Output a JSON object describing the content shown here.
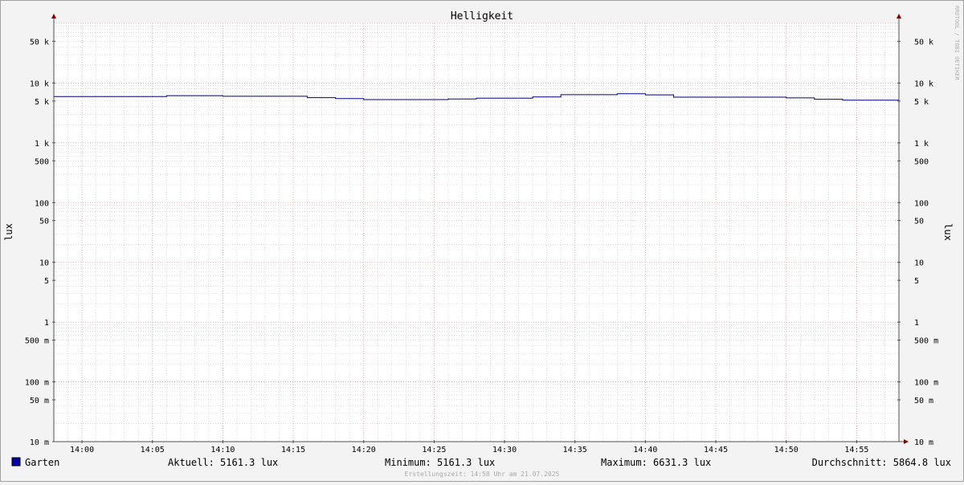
{
  "chart_data": {
    "type": "line",
    "title": "Helligkeit",
    "ylabel": "lux",
    "ylabel_right": "lux",
    "watermark": "RRDTOOL / TOBI OETIKER",
    "scale": "log",
    "ylim": [
      0.01,
      100000
    ],
    "xlim": [
      "13:58",
      "14:58"
    ],
    "grid": true,
    "y_ticks": [
      {
        "value": 50000,
        "label": "50 k"
      },
      {
        "value": 10000,
        "label": "10 k"
      },
      {
        "value": 5000,
        "label": "5 k"
      },
      {
        "value": 1000,
        "label": "1 k"
      },
      {
        "value": 500,
        "label": "500"
      },
      {
        "value": 100,
        "label": "100"
      },
      {
        "value": 50,
        "label": "50"
      },
      {
        "value": 10,
        "label": "10"
      },
      {
        "value": 5,
        "label": "5"
      },
      {
        "value": 1,
        "label": "1"
      },
      {
        "value": 0.5,
        "label": "500 m"
      },
      {
        "value": 0.1,
        "label": "100 m"
      },
      {
        "value": 0.05,
        "label": "50 m"
      },
      {
        "value": 0.01,
        "label": "10 m"
      }
    ],
    "x_ticks": [
      "14:00",
      "14:05",
      "14:10",
      "14:15",
      "14:20",
      "14:25",
      "14:30",
      "14:35",
      "14:40",
      "14:45",
      "14:50",
      "14:55"
    ],
    "series": [
      {
        "name": "Garten",
        "color": "#000080",
        "points": [
          [
            "13:58",
            5950
          ],
          [
            "14:06",
            6150
          ],
          [
            "14:10",
            6000
          ],
          [
            "14:16",
            5700
          ],
          [
            "14:18",
            5500
          ],
          [
            "14:20",
            5300
          ],
          [
            "14:26",
            5400
          ],
          [
            "14:28",
            5600
          ],
          [
            "14:32",
            5850
          ],
          [
            "14:34",
            6400
          ],
          [
            "14:38",
            6631.3
          ],
          [
            "14:40",
            6350
          ],
          [
            "14:42",
            5800
          ],
          [
            "14:50",
            5650
          ],
          [
            "14:52",
            5350
          ],
          [
            "14:54",
            5161.3
          ],
          [
            "14:58",
            5161.3
          ]
        ]
      }
    ]
  },
  "legend": {
    "swatch_color": "#0000aa",
    "series_name": "Garten",
    "current": "Aktuell: 5161.3 lux",
    "minimum": "Minimum: 5161.3 lux",
    "maximum": "Maximum: 6631.3 lux",
    "average": "Durchschnitt: 5864.8 lux"
  },
  "footer": "Erstellungszeit: 14:58 Uhr am 21.07.2025",
  "colors": {
    "major_grid": "#e8a0a8",
    "minor_grid": "#c8c8c8",
    "axis": "#505050",
    "arrow": "#8b0000"
  }
}
